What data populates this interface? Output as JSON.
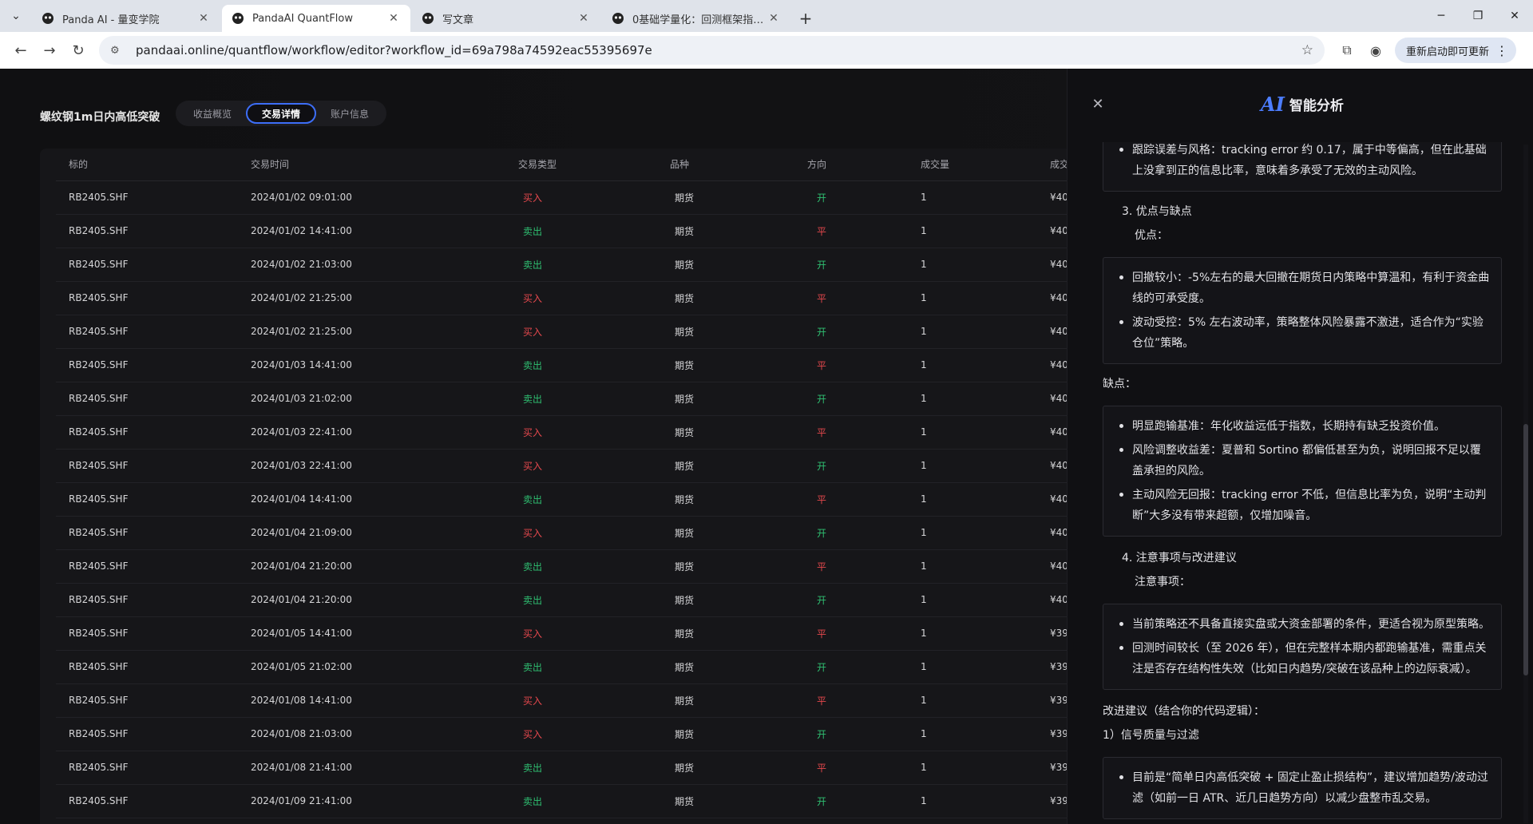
{
  "browser": {
    "tabs": [
      {
        "title": "Panda AI - 量变学院",
        "active": false
      },
      {
        "title": "PandaAI QuantFlow",
        "active": true
      },
      {
        "title": "写文章",
        "active": false
      },
      {
        "title": "0基础学量化：回测框架指标介绍",
        "active": false
      }
    ],
    "url": "pandaai.online/quantflow/workflow/editor?workflow_id=69a798a74592eac55395697e",
    "update_button": "重新启动即可更新"
  },
  "app": {
    "strategy_title": "螺纹钢1m日内高低突破",
    "segments": [
      {
        "label": "收益概览",
        "active": false
      },
      {
        "label": "交易详情",
        "active": true
      },
      {
        "label": "账户信息",
        "active": false
      }
    ],
    "table": {
      "columns": [
        "标的",
        "交易时间",
        "交易类型",
        "品种",
        "方向",
        "成交量",
        "成交"
      ],
      "rows": [
        {
          "symbol": "RB2405.SHF",
          "time": "2024/01/02 09:01:00",
          "type": "买入",
          "kind": "期货",
          "dir": "开",
          "vol": "1",
          "amt": "¥40"
        },
        {
          "symbol": "RB2405.SHF",
          "time": "2024/01/02 14:41:00",
          "type": "卖出",
          "kind": "期货",
          "dir": "平",
          "vol": "1",
          "amt": "¥40"
        },
        {
          "symbol": "RB2405.SHF",
          "time": "2024/01/02 21:03:00",
          "type": "卖出",
          "kind": "期货",
          "dir": "开",
          "vol": "1",
          "amt": "¥40"
        },
        {
          "symbol": "RB2405.SHF",
          "time": "2024/01/02 21:25:00",
          "type": "买入",
          "kind": "期货",
          "dir": "平",
          "vol": "1",
          "amt": "¥40"
        },
        {
          "symbol": "RB2405.SHF",
          "time": "2024/01/02 21:25:00",
          "type": "买入",
          "kind": "期货",
          "dir": "开",
          "vol": "1",
          "amt": "¥40"
        },
        {
          "symbol": "RB2405.SHF",
          "time": "2024/01/03 14:41:00",
          "type": "卖出",
          "kind": "期货",
          "dir": "平",
          "vol": "1",
          "amt": "¥40"
        },
        {
          "symbol": "RB2405.SHF",
          "time": "2024/01/03 21:02:00",
          "type": "卖出",
          "kind": "期货",
          "dir": "开",
          "vol": "1",
          "amt": "¥40"
        },
        {
          "symbol": "RB2405.SHF",
          "time": "2024/01/03 22:41:00",
          "type": "买入",
          "kind": "期货",
          "dir": "平",
          "vol": "1",
          "amt": "¥40"
        },
        {
          "symbol": "RB2405.SHF",
          "time": "2024/01/03 22:41:00",
          "type": "买入",
          "kind": "期货",
          "dir": "开",
          "vol": "1",
          "amt": "¥40"
        },
        {
          "symbol": "RB2405.SHF",
          "time": "2024/01/04 14:41:00",
          "type": "卖出",
          "kind": "期货",
          "dir": "平",
          "vol": "1",
          "amt": "¥40"
        },
        {
          "symbol": "RB2405.SHF",
          "time": "2024/01/04 21:09:00",
          "type": "买入",
          "kind": "期货",
          "dir": "开",
          "vol": "1",
          "amt": "¥40"
        },
        {
          "symbol": "RB2405.SHF",
          "time": "2024/01/04 21:20:00",
          "type": "卖出",
          "kind": "期货",
          "dir": "平",
          "vol": "1",
          "amt": "¥40"
        },
        {
          "symbol": "RB2405.SHF",
          "time": "2024/01/04 21:20:00",
          "type": "卖出",
          "kind": "期货",
          "dir": "开",
          "vol": "1",
          "amt": "¥40"
        },
        {
          "symbol": "RB2405.SHF",
          "time": "2024/01/05 14:41:00",
          "type": "买入",
          "kind": "期货",
          "dir": "平",
          "vol": "1",
          "amt": "¥39"
        },
        {
          "symbol": "RB2405.SHF",
          "time": "2024/01/05 21:02:00",
          "type": "卖出",
          "kind": "期货",
          "dir": "开",
          "vol": "1",
          "amt": "¥39"
        },
        {
          "symbol": "RB2405.SHF",
          "time": "2024/01/08 14:41:00",
          "type": "买入",
          "kind": "期货",
          "dir": "平",
          "vol": "1",
          "amt": "¥39"
        },
        {
          "symbol": "RB2405.SHF",
          "time": "2024/01/08 21:03:00",
          "type": "买入",
          "kind": "期货",
          "dir": "开",
          "vol": "1",
          "amt": "¥39"
        },
        {
          "symbol": "RB2405.SHF",
          "time": "2024/01/08 21:41:00",
          "type": "卖出",
          "kind": "期货",
          "dir": "平",
          "vol": "1",
          "amt": "¥39"
        },
        {
          "symbol": "RB2405.SHF",
          "time": "2024/01/09 21:41:00",
          "type": "卖出",
          "kind": "期货",
          "dir": "开",
          "vol": "1",
          "amt": "¥39"
        }
      ]
    }
  },
  "ai_panel": {
    "title_mark": "AI",
    "title": "智能分析",
    "top_partial": "跟踪误差与风格：tracking error 约 0.17，属于中等偏高，但在此基础上没拿到正的信息比率，意味着多承受了无效的主动风险。",
    "section3_heading": "3. 优点与缺点",
    "pros_label": "优点：",
    "pros": [
      "回撤较小：-5%左右的最大回撤在期货日内策略中算温和，有利于资金曲线的可承受度。",
      "波动受控：5% 左右波动率，策略整体风险暴露不激进，适合作为“实验仓位”策略。"
    ],
    "cons_label": "缺点：",
    "cons": [
      "明显跑输基准：年化收益远低于指数，长期持有缺乏投资价值。",
      "风险调整收益差：夏普和 Sortino 都偏低甚至为负，说明回报不足以覆盖承担的风险。",
      "主动风险无回报：tracking error 不低，但信息比率为负，说明“主动判断”大多没有带来超额，仅增加噪音。"
    ],
    "section4_heading": "4. 注意事项与改进建议",
    "notes_label": "注意事项：",
    "notes": [
      "当前策略还不具备直接实盘或大资金部署的条件，更适合视为原型策略。",
      "回测时间较长（至 2026 年），但在完整样本期内都跑输基准，需重点关注是否存在结构性失效（比如日内趋势/突破在该品种上的边际衰减）。"
    ],
    "improve_label": "改进建议（结合你的代码逻辑）：",
    "improve_sub": "1）信号质量与过滤",
    "improve_items": [
      "目前是“简单日内高低突破 + 固定止盈止损结构”，建议增加趋势/波动过滤（如前一日 ATR、近几日趋势方向）以减少盘整市乱交易。"
    ]
  }
}
